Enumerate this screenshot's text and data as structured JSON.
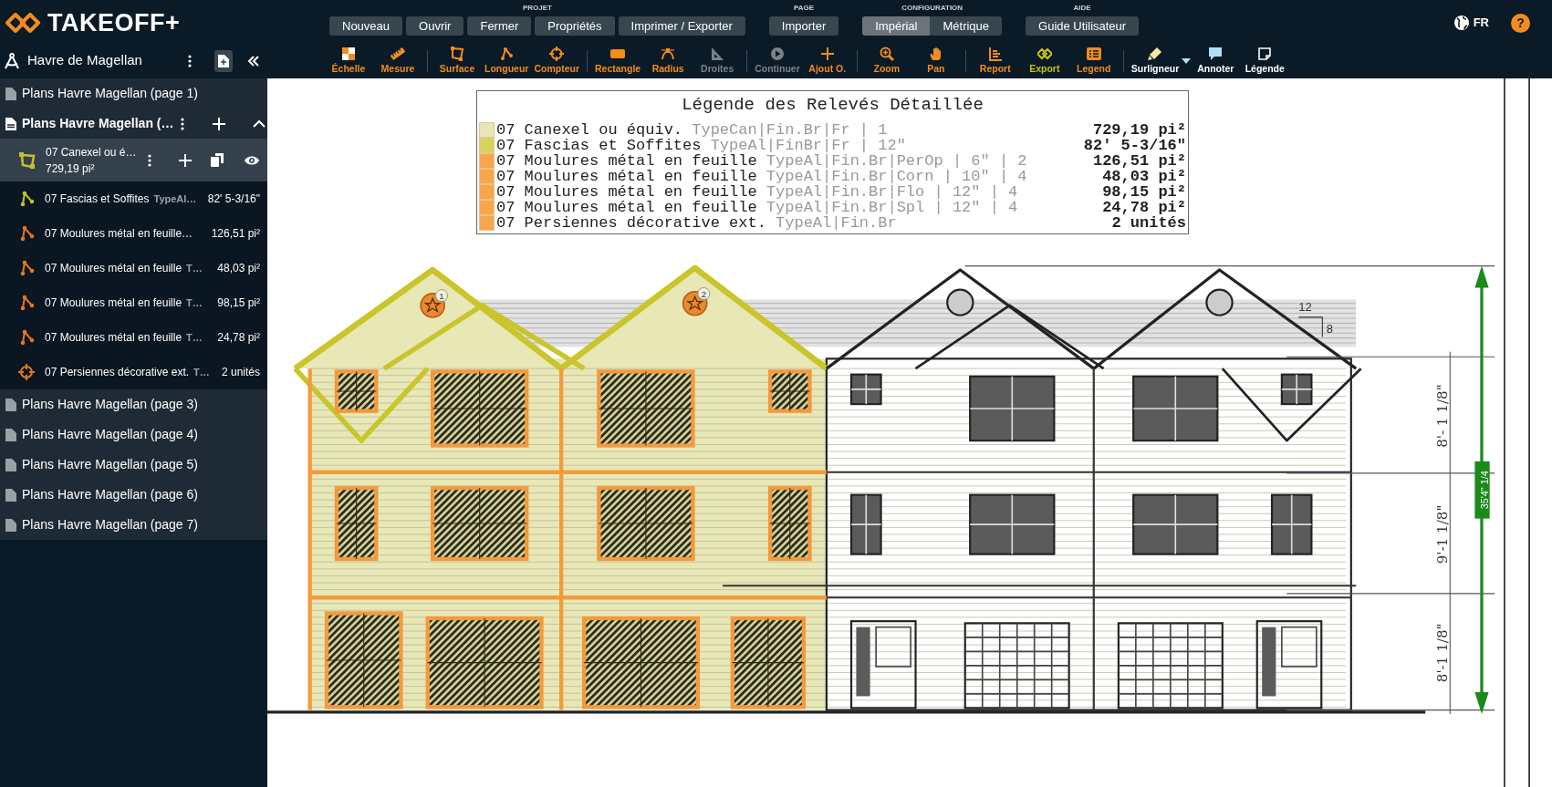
{
  "app": {
    "logo": "TAKEOFF+"
  },
  "menu_groups": [
    {
      "label": "PROJET",
      "kind": "buttons",
      "buttons": [
        {
          "label": "Nouveau"
        },
        {
          "label": "Ouvrir"
        },
        {
          "label": "Fermer"
        },
        {
          "label": "Propriétés"
        },
        {
          "label": "Imprimer / Exporter"
        }
      ]
    },
    {
      "label": "PAGE",
      "kind": "buttons",
      "buttons": [
        {
          "label": "Importer"
        }
      ]
    },
    {
      "label": "CONFIGURATION",
      "kind": "toggle",
      "buttons": [
        {
          "label": "Impérial",
          "selected": true
        },
        {
          "label": "Métrique",
          "selected": false
        }
      ]
    },
    {
      "label": "AIDE",
      "kind": "buttons",
      "buttons": [
        {
          "label": "Guide Utilisateur"
        }
      ]
    }
  ],
  "language": "FR",
  "help": "?",
  "project": {
    "title": "Havre de Magellan"
  },
  "toolbar": {
    "groups": [
      [
        {
          "label": "Échelle",
          "color": "#f28c1e",
          "disabled": false
        },
        {
          "label": "Mesure",
          "color": "#f28c1e",
          "disabled": false
        }
      ],
      [
        {
          "label": "Surface",
          "color": "#f28c1e",
          "disabled": false
        },
        {
          "label": "Longueur",
          "color": "#f28c1e",
          "disabled": false
        },
        {
          "label": "Compteur",
          "color": "#f28c1e",
          "disabled": false
        }
      ],
      [
        {
          "label": "Rectangle",
          "color": "#f28c1e",
          "disabled": false
        },
        {
          "label": "Radius",
          "color": "#f28c1e",
          "disabled": false
        },
        {
          "label": "Droites",
          "disabled": true
        }
      ],
      [
        {
          "label": "Continuer",
          "disabled": true
        },
        {
          "label": "Ajout O.",
          "color": "#f28c1e",
          "disabled": false
        }
      ],
      [
        {
          "label": "Zoom",
          "color": "#f28c1e",
          "disabled": false
        },
        {
          "label": "Pan",
          "color": "#f28c1e",
          "disabled": false
        }
      ],
      [
        {
          "label": "Report",
          "color": "#f28c1e",
          "disabled": false
        },
        {
          "label": "Export",
          "color": "#c9c21b",
          "disabled": false
        },
        {
          "label": "Legend",
          "color": "#f28c1e",
          "disabled": false
        }
      ],
      [
        {
          "label": "Surligneur",
          "color": "#ffffff",
          "disabled": false,
          "dropdown": true
        },
        {
          "label": "Annoter",
          "color": "#ffffff",
          "disabled": false
        },
        {
          "label": "Légende",
          "color": "#ffffff",
          "disabled": false
        }
      ]
    ]
  },
  "pages": [
    {
      "title": "Plans Havre Magellan (page 1)",
      "expanded": false
    },
    {
      "title": "Plans Havre Magellan (…",
      "expanded": true,
      "measurements": [
        {
          "name": "07 Canexel ou é…",
          "value": "729,19 pi²",
          "kind": "area",
          "color": "#c5c12a",
          "selected": true
        },
        {
          "name": "07 Fascias et Soffites",
          "hint": "TypeAl…",
          "value": "82' 5-3/16\"",
          "kind": "length",
          "color": "#c5c12a",
          "selected": false
        },
        {
          "name": "07 Moulures métal en feuille…",
          "value": "126,51 pi²",
          "kind": "length",
          "color": "#e9771d",
          "selected": false
        },
        {
          "name": "07 Moulures métal en feuille",
          "hint": "T…",
          "value": "48,03 pi²",
          "kind": "length",
          "color": "#e9771d",
          "selected": false
        },
        {
          "name": "07 Moulures métal en feuille",
          "hint": "T…",
          "value": "98,15 pi²",
          "kind": "length",
          "color": "#e9771d",
          "selected": false
        },
        {
          "name": "07 Moulures métal en feuille",
          "hint": "T…",
          "value": "24,78 pi²",
          "kind": "length",
          "color": "#e9771d",
          "selected": false
        },
        {
          "name": "07 Persiennes décorative ext.",
          "hint": "T…",
          "value": "2 unités",
          "kind": "count",
          "color": "#e9771d",
          "selected": false
        }
      ]
    },
    {
      "title": "Plans Havre Magellan (page 3)",
      "expanded": false
    },
    {
      "title": "Plans Havre Magellan (page 4)",
      "expanded": false
    },
    {
      "title": "Plans Havre Magellan (page 5)",
      "expanded": false
    },
    {
      "title": "Plans Havre Magellan (page 6)",
      "expanded": false
    },
    {
      "title": "Plans Havre Magellan (page 7)",
      "expanded": false
    }
  ],
  "legend": {
    "title": "Légende des Relevés Détaillée",
    "rows": [
      {
        "color": "#e9e6b6",
        "name": "07 Canexel ou équiv.",
        "detail": "TypeCan|Fin.Br|Fr | 1",
        "value": "729,19 pi²"
      },
      {
        "color": "#d6d55a",
        "name": "07 Fascias et Soffites",
        "detail": "TypeAl|FinBr|Fr | 12\"",
        "value": "82' 5-3/16\""
      },
      {
        "color": "#f9a54c",
        "name": "07 Moulures métal en feuille",
        "detail": "TypeAl|Fin.Br|PerOp | 6\" | 2",
        "value": "126,51 pi²"
      },
      {
        "color": "#f9a54c",
        "name": "07 Moulures métal en feuille",
        "detail": "TypeAl|Fin.Br|Corn | 10\" | 4",
        "value": "48,03 pi²"
      },
      {
        "color": "#f9a54c",
        "name": "07 Moulures métal en feuille",
        "detail": "TypeAl|Fin.Br|Flo | 12\" | 4",
        "value": "98,15 pi²"
      },
      {
        "color": "#f9a54c",
        "name": "07 Moulures métal en feuille",
        "detail": "TypeAl|Fin.Br|Spl | 12\" | 4",
        "value": "24,78 pi²"
      },
      {
        "color": "#f9a54c",
        "name": "07 Persiennes décorative ext.",
        "detail": "TypeAl|Fin.Br",
        "value": "2 unités"
      }
    ]
  },
  "drawing": {
    "counters": [
      {
        "number": "1"
      },
      {
        "number": "2"
      }
    ],
    "dimension_labels": [
      "8'- 1 1/8\"",
      "9'-1 1/8\"",
      "8'-1 1/8\""
    ],
    "total_dimension": "35'4\" 1/4",
    "roof_pitch": {
      "run": "12",
      "rise": "8"
    }
  }
}
